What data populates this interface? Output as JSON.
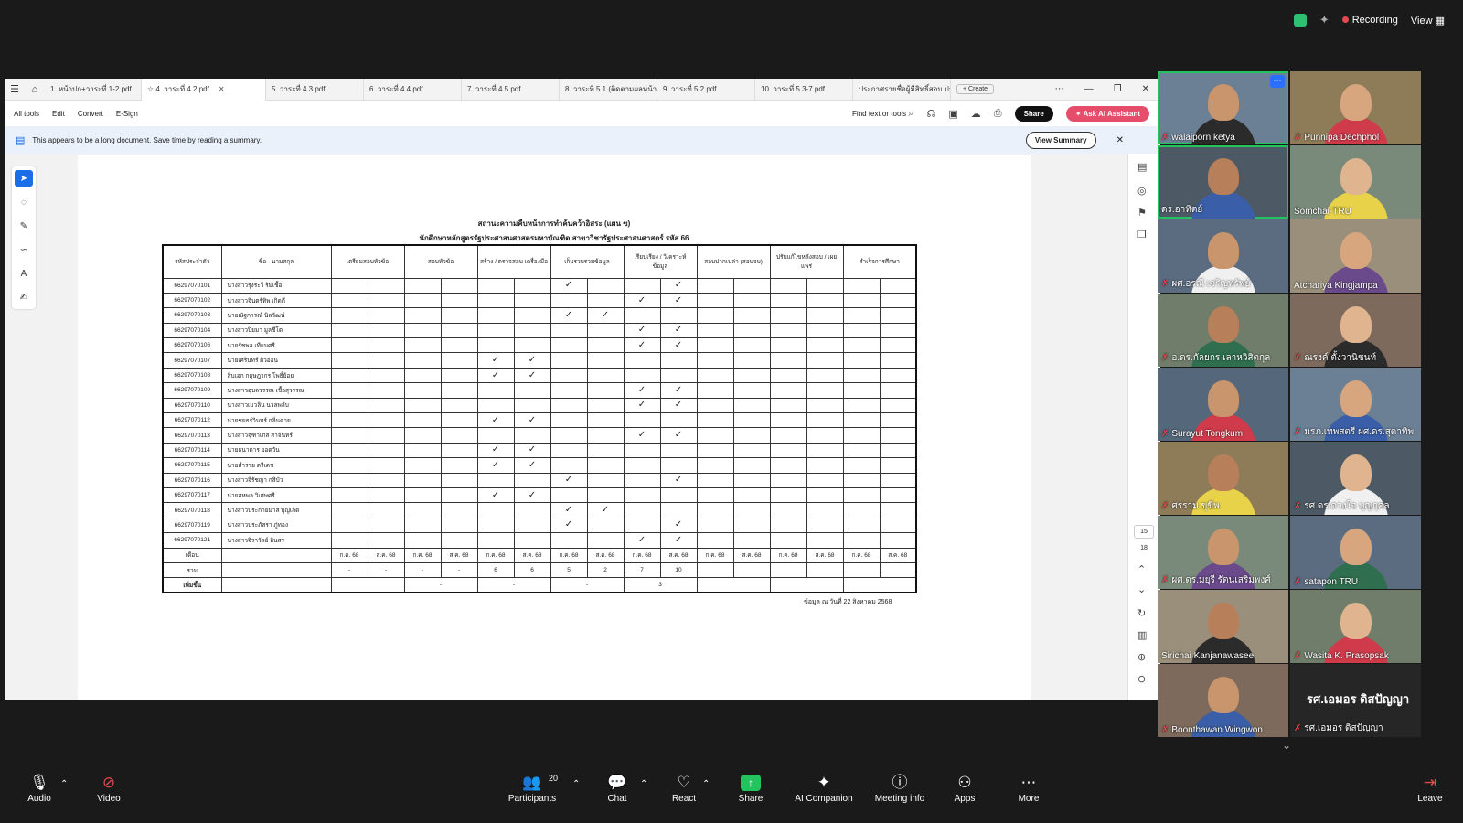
{
  "zoom_header": {
    "recording": "Recording",
    "view": "View"
  },
  "acrobat": {
    "tabs": [
      "1. หน้าปก+วาระที่ 1-2.pdf",
      "4. วาระที่ 4.2.pdf",
      "5. วาระที่ 4.3.pdf",
      "6. วาระที่ 4.4.pdf",
      "7. วาระที่ 4.5.pdf",
      "8. วาระที่ 5.1 (ติดตามผลหน้า...",
      "9. วาระที่ 5.2.pdf",
      "10. วาระที่ 5.3-7.pdf",
      "ประกาศรายชื่อผู้มีสิทธิ์สอบ ปร..."
    ],
    "create": "Create",
    "menu": [
      "All tools",
      "Edit",
      "Convert",
      "E-Sign"
    ],
    "find": "Find text or tools",
    "share": "Share",
    "ai": "Ask AI Assistant",
    "banner": "This appears to be a long document. Save time by reading a summary.",
    "view_summary": "View Summary",
    "page_current": "15",
    "page_total": "18"
  },
  "document": {
    "title1": "สถานะความคืบหน้าการทำค้นคว้าอิสระ (แผน ข)",
    "title2": "นักศึกษาหลักสูตรรัฐประศาสนศาสตรมหาบัณฑิต สาขาวิชารัฐประศาสนศาสตร์ รหัส 66",
    "headers": [
      "รหัสประจำตัว",
      "ชื่อ - นามสกุล",
      "เตรียมสอบหัวข้อ",
      "สอบหัวข้อ",
      "สร้าง / ตรวจสอบ เครื่องมือ",
      "เก็บรวบรวมข้อมูล",
      "เรียบเรียง / วิเคราะห์ ข้อมูล",
      "สอบปากเปล่า (สอบจบ)",
      "ปรับแก้ไขหลังสอบ / เผยแพร่",
      "สำเร็จการศึกษา"
    ],
    "students": [
      {
        "code": "66297070101",
        "name": "นางสาวรุ่งระวี ริมเชื้อ",
        "marks": [
          0,
          0,
          0,
          0,
          0,
          0,
          1,
          0,
          0,
          1,
          0,
          0,
          0,
          0,
          0,
          0
        ]
      },
      {
        "code": "66297070102",
        "name": "นางสาวจินตร์ทิพ เกิดดี",
        "marks": [
          0,
          0,
          0,
          0,
          0,
          0,
          0,
          0,
          1,
          1,
          0,
          0,
          0,
          0,
          0,
          0
        ]
      },
      {
        "code": "66297070103",
        "name": "นายณัฐการณ์ นิลวัฒน์",
        "marks": [
          0,
          0,
          0,
          0,
          0,
          0,
          1,
          1,
          0,
          0,
          0,
          0,
          0,
          0,
          0,
          0
        ]
      },
      {
        "code": "66297070104",
        "name": "นางสาวปิยมา มูลชีโต",
        "marks": [
          0,
          0,
          0,
          0,
          0,
          0,
          0,
          0,
          1,
          1,
          0,
          0,
          0,
          0,
          0,
          0
        ]
      },
      {
        "code": "66297070106",
        "name": "นายรัชพล เทียนศรี",
        "marks": [
          0,
          0,
          0,
          0,
          0,
          0,
          0,
          0,
          1,
          1,
          0,
          0,
          0,
          0,
          0,
          0
        ]
      },
      {
        "code": "66297070107",
        "name": "นายเศรินทร์ ผิวอ่อน",
        "marks": [
          0,
          0,
          0,
          0,
          1,
          1,
          0,
          0,
          0,
          0,
          0,
          0,
          0,
          0,
          0,
          0
        ]
      },
      {
        "code": "66297070108",
        "name": "สิบเอก กฤษฎากร โพธิ์ย้อย",
        "marks": [
          0,
          0,
          0,
          0,
          1,
          1,
          0,
          0,
          0,
          0,
          0,
          0,
          0,
          0,
          0,
          0
        ]
      },
      {
        "code": "66297070109",
        "name": "นางสาวอุบลวรรณ เชื้อสุวรรณ",
        "marks": [
          0,
          0,
          0,
          0,
          0,
          0,
          0,
          0,
          1,
          1,
          0,
          0,
          0,
          0,
          0,
          0
        ]
      },
      {
        "code": "66297070110",
        "name": "นางสาวเมวลิน นวลพลับ",
        "marks": [
          0,
          0,
          0,
          0,
          0,
          0,
          0,
          0,
          1,
          1,
          0,
          0,
          0,
          0,
          0,
          0
        ]
      },
      {
        "code": "66297070112",
        "name": "นายชยธร์วินทร์ กลิ่นต่าย",
        "marks": [
          0,
          0,
          0,
          0,
          1,
          1,
          0,
          0,
          0,
          0,
          0,
          0,
          0,
          0,
          0,
          0
        ]
      },
      {
        "code": "66297070113",
        "name": "นางสาวจุฑาเภส สาจันทร์",
        "marks": [
          0,
          0,
          0,
          0,
          0,
          0,
          0,
          0,
          1,
          1,
          0,
          0,
          0,
          0,
          0,
          0
        ]
      },
      {
        "code": "66297070114",
        "name": "นายธนาดาร ยอดวัน",
        "marks": [
          0,
          0,
          0,
          0,
          1,
          1,
          0,
          0,
          0,
          0,
          0,
          0,
          0,
          0,
          0,
          0
        ]
      },
      {
        "code": "66297070115",
        "name": "นายสำรวย ตรีเดช",
        "marks": [
          0,
          0,
          0,
          0,
          1,
          1,
          0,
          0,
          0,
          0,
          0,
          0,
          0,
          0,
          0,
          0
        ]
      },
      {
        "code": "66297070116",
        "name": "นางสาวจิรัชญา กสิบัว",
        "marks": [
          0,
          0,
          0,
          0,
          0,
          0,
          1,
          0,
          0,
          1,
          0,
          0,
          0,
          0,
          0,
          0
        ]
      },
      {
        "code": "66297070117",
        "name": "นายสหพล วิเศษศรี",
        "marks": [
          0,
          0,
          0,
          0,
          1,
          1,
          0,
          0,
          0,
          0,
          0,
          0,
          0,
          0,
          0,
          0
        ]
      },
      {
        "code": "66297070118",
        "name": "นางสาวประกายมาส บุญเกิด",
        "marks": [
          0,
          0,
          0,
          0,
          0,
          0,
          1,
          1,
          0,
          0,
          0,
          0,
          0,
          0,
          0,
          0
        ]
      },
      {
        "code": "66297070119",
        "name": "นางสาวประภัสรา ภู่ทอง",
        "marks": [
          0,
          0,
          0,
          0,
          0,
          0,
          1,
          0,
          0,
          1,
          0,
          0,
          0,
          0,
          0,
          0
        ]
      },
      {
        "code": "66297070121",
        "name": "นางสาวจิราวัลย์ อินสร",
        "marks": [
          0,
          0,
          0,
          0,
          0,
          0,
          0,
          0,
          1,
          1,
          0,
          0,
          0,
          0,
          0,
          0
        ]
      }
    ],
    "month_label": "เดือน",
    "months": [
      "ก.ค. 68",
      "ส.ค. 68"
    ],
    "total_label": "รวม",
    "totals": [
      "-",
      "-",
      "-",
      "-",
      "6",
      "6",
      "5",
      "2",
      "7",
      "10",
      "",
      "",
      "",
      "",
      "",
      ""
    ],
    "increase_label": "เพิ่มขึ้น",
    "increase": [
      "",
      "-",
      "-",
      "-",
      "3",
      "",
      "",
      ""
    ],
    "as_of": "ข้อมูล ณ วันที่ 22 สิงหาคม 2568"
  },
  "participants": [
    {
      "name": "walaiporn ketya",
      "muted": true
    },
    {
      "name": "Punnipa Dechphol",
      "muted": true
    },
    {
      "name": "ดร.อาทิตย์",
      "muted": false
    },
    {
      "name": "Somchai-TRU",
      "muted": false
    },
    {
      "name": "ผศ.อรณี เจริญทรัพย์",
      "muted": true
    },
    {
      "name": "Atchariya Kingjampa",
      "muted": false
    },
    {
      "name": "อ.ดร.กัลยกร เลาหวิสิตกุล",
      "muted": true
    },
    {
      "name": "ณรงค์ ตั้งวานิชนท์",
      "muted": true
    },
    {
      "name": "Surayut Tongkum",
      "muted": true
    },
    {
      "name": "มรภ.เทพสตรี ผศ.ดร.สุดาทิพ",
      "muted": true
    },
    {
      "name": "ศรราม ขุขีพ",
      "muted": true
    },
    {
      "name": "รศ.ดร.ดวงใจ บุญกุศล",
      "muted": true
    },
    {
      "name": "ผศ.ดร.มยุรี รัตนเสริมพงศ์",
      "muted": true
    },
    {
      "name": "satapon TRU",
      "muted": true
    },
    {
      "name": "Sirichai Kanjanawasee",
      "muted": false
    },
    {
      "name": "Wasita K. Prasopsak",
      "muted": true
    },
    {
      "name": "Boonthawan Wingwon",
      "muted": true
    },
    {
      "name": "รศ.เอมอร ดิสปัญญา",
      "muted": true
    }
  ],
  "participant_text_tile": "รศ.เอมอร ดิสปัญญา",
  "toolbar": {
    "audio": "Audio",
    "video": "Video",
    "participants": "Participants",
    "participants_count": "20",
    "chat": "Chat",
    "react": "React",
    "share": "Share",
    "ai": "AI Companion",
    "meeting_info": "Meeting info",
    "apps": "Apps",
    "more": "More",
    "leave": "Leave"
  },
  "colors": {
    "accent_green": "#23c45e",
    "ai_pink": "#e64d6a",
    "record_red": "#e5484d",
    "acrobat_blue": "#1a6fe8"
  }
}
